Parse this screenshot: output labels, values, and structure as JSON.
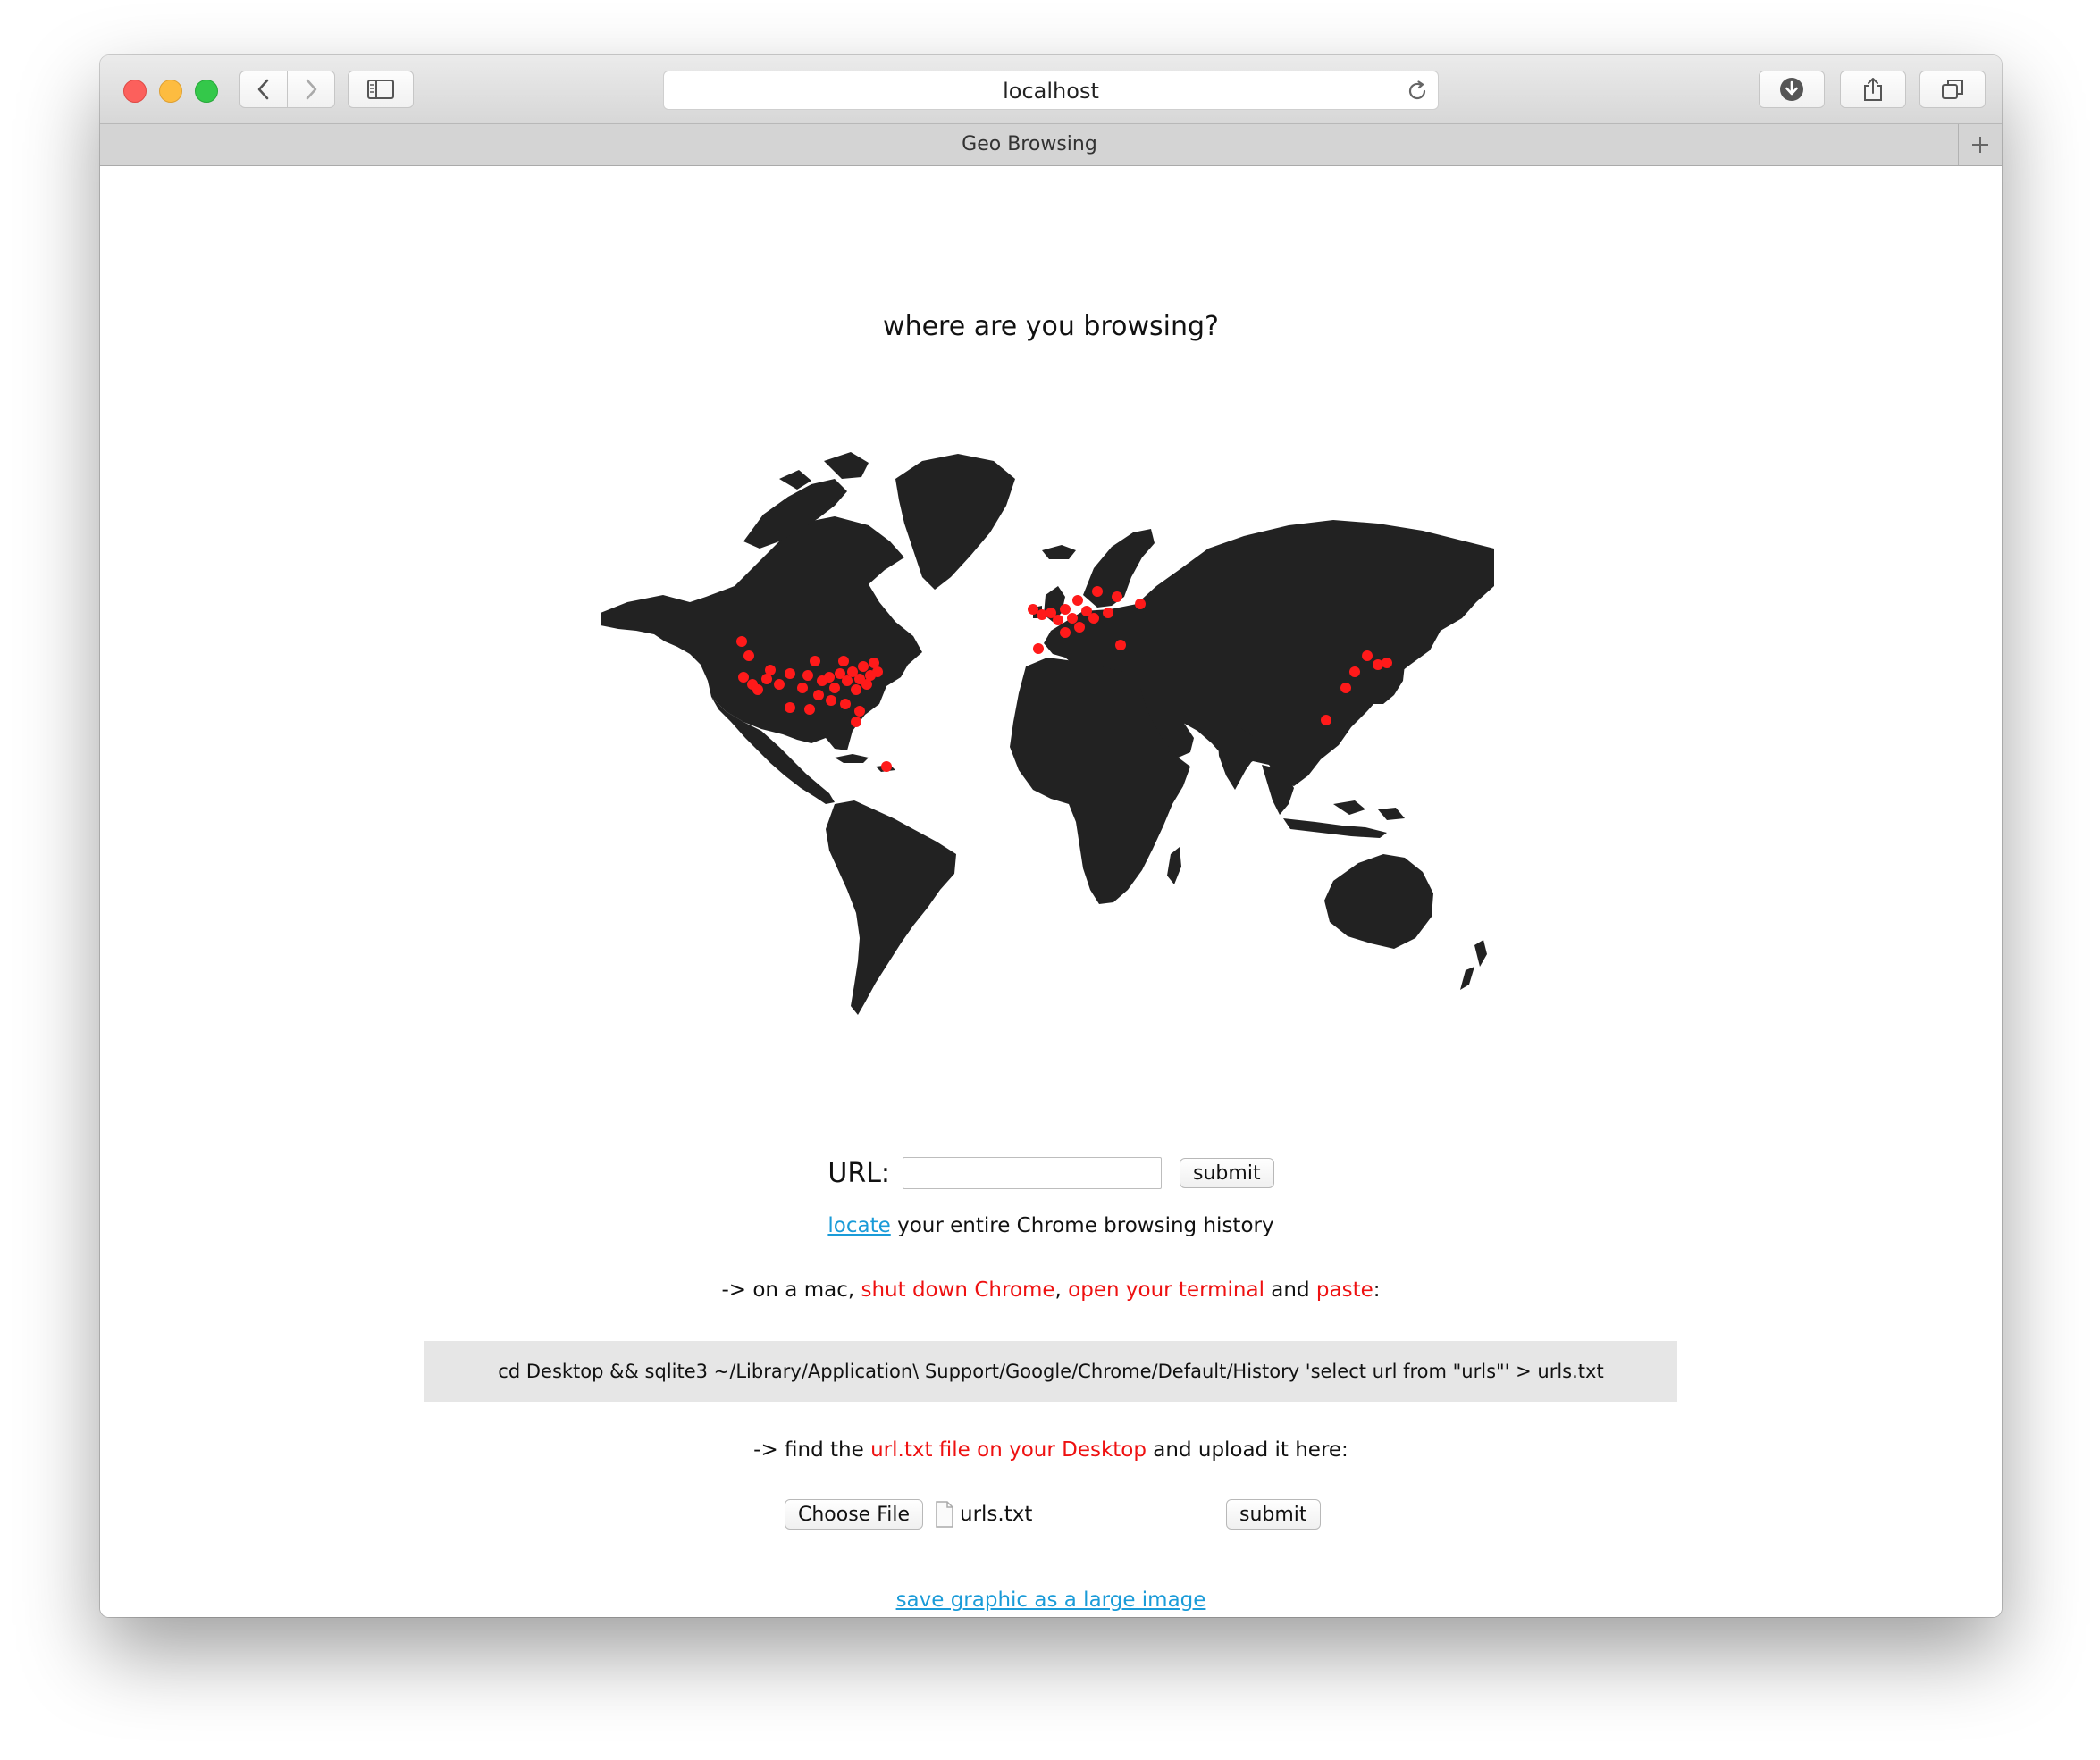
{
  "browser": {
    "address": "localhost",
    "tab_title": "Geo Browsing"
  },
  "page": {
    "title": "where are you browsing?",
    "url_label": "URL:",
    "url_value": "",
    "submit_label": "submit",
    "locate_link": "locate",
    "locate_rest": " your entire Chrome browsing history",
    "instr1": {
      "prefix": "-> on a mac, ",
      "shut_down": "shut down Chrome",
      "comma": ", ",
      "open_terminal": "open your terminal",
      "and": " and ",
      "paste": "paste",
      "colon": ":"
    },
    "command": "cd Desktop && sqlite3 ~/Library/Application\\ Support/Google/Chrome/Default/History 'select url from \"urls\"' > urls.txt",
    "instr2": {
      "prefix": "-> find the ",
      "highlight": "url.txt file on your Desktop",
      "suffix": " and upload it here:"
    },
    "choose_file_label": "Choose File",
    "file_name": "urls.txt",
    "submit2_label": "submit",
    "save_link": "save graphic as a large image"
  },
  "colors": {
    "land": "#222222",
    "marker": "#ff1a1a",
    "link": "#1a9bd8",
    "highlight": "#ee1111",
    "code_bg": "#e6e6e6"
  },
  "icons": [
    "back-arrow-icon",
    "forward-arrow-icon",
    "sidebar-icon",
    "reload-icon",
    "download-icon",
    "share-icon",
    "tabs-icon",
    "plus-icon",
    "document-icon"
  ]
}
